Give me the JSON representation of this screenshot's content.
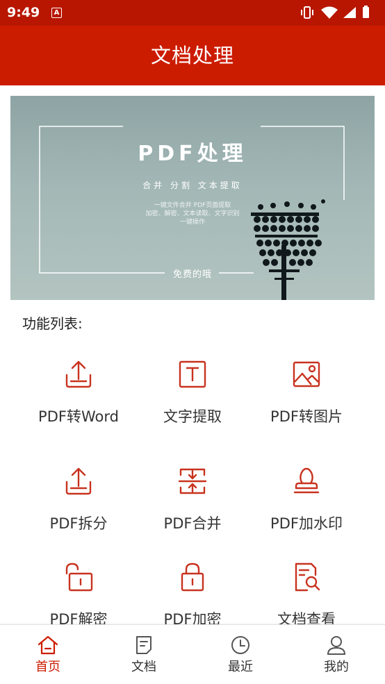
{
  "status_bar": {
    "time": "9:49",
    "notification_glyph": "A",
    "icons": [
      "vibrate-icon",
      "wifi-icon",
      "signal-icon",
      "battery-icon"
    ]
  },
  "app_bar": {
    "title": "文档处理"
  },
  "banner": {
    "title": "PDF处理",
    "subtitle": "合并  分割  文本提取",
    "desc_line1": "一键文件合并 PDF页面提取",
    "desc_line2": "加密、解密、文本读取、文字识别",
    "desc_line3": "一键操作",
    "free_label": "免费的哦"
  },
  "section_title": "功能列表:",
  "features": [
    {
      "label": "PDF转Word",
      "icon": "upload-tray-icon"
    },
    {
      "label": "文字提取",
      "icon": "text-box-icon"
    },
    {
      "label": "PDF转图片",
      "icon": "image-icon"
    },
    {
      "label": "PDF拆分",
      "icon": "upload-tray-icon"
    },
    {
      "label": "PDF合并",
      "icon": "merge-icon"
    },
    {
      "label": "PDF加水印",
      "icon": "stamp-icon"
    },
    {
      "label": "PDF解密",
      "icon": "unlock-icon"
    },
    {
      "label": "PDF加密",
      "icon": "lock-icon"
    },
    {
      "label": "文档查看",
      "icon": "document-search-icon"
    }
  ],
  "bottom_nav": [
    {
      "label": "首页",
      "icon": "home-icon",
      "active": true
    },
    {
      "label": "文档",
      "icon": "document-icon",
      "active": false
    },
    {
      "label": "最近",
      "icon": "clock-icon",
      "active": false
    },
    {
      "label": "我的",
      "icon": "user-icon",
      "active": false
    }
  ],
  "colors": {
    "primary": "#cc1c00",
    "status_bar": "#b81600",
    "icon_red": "#c8321e"
  }
}
